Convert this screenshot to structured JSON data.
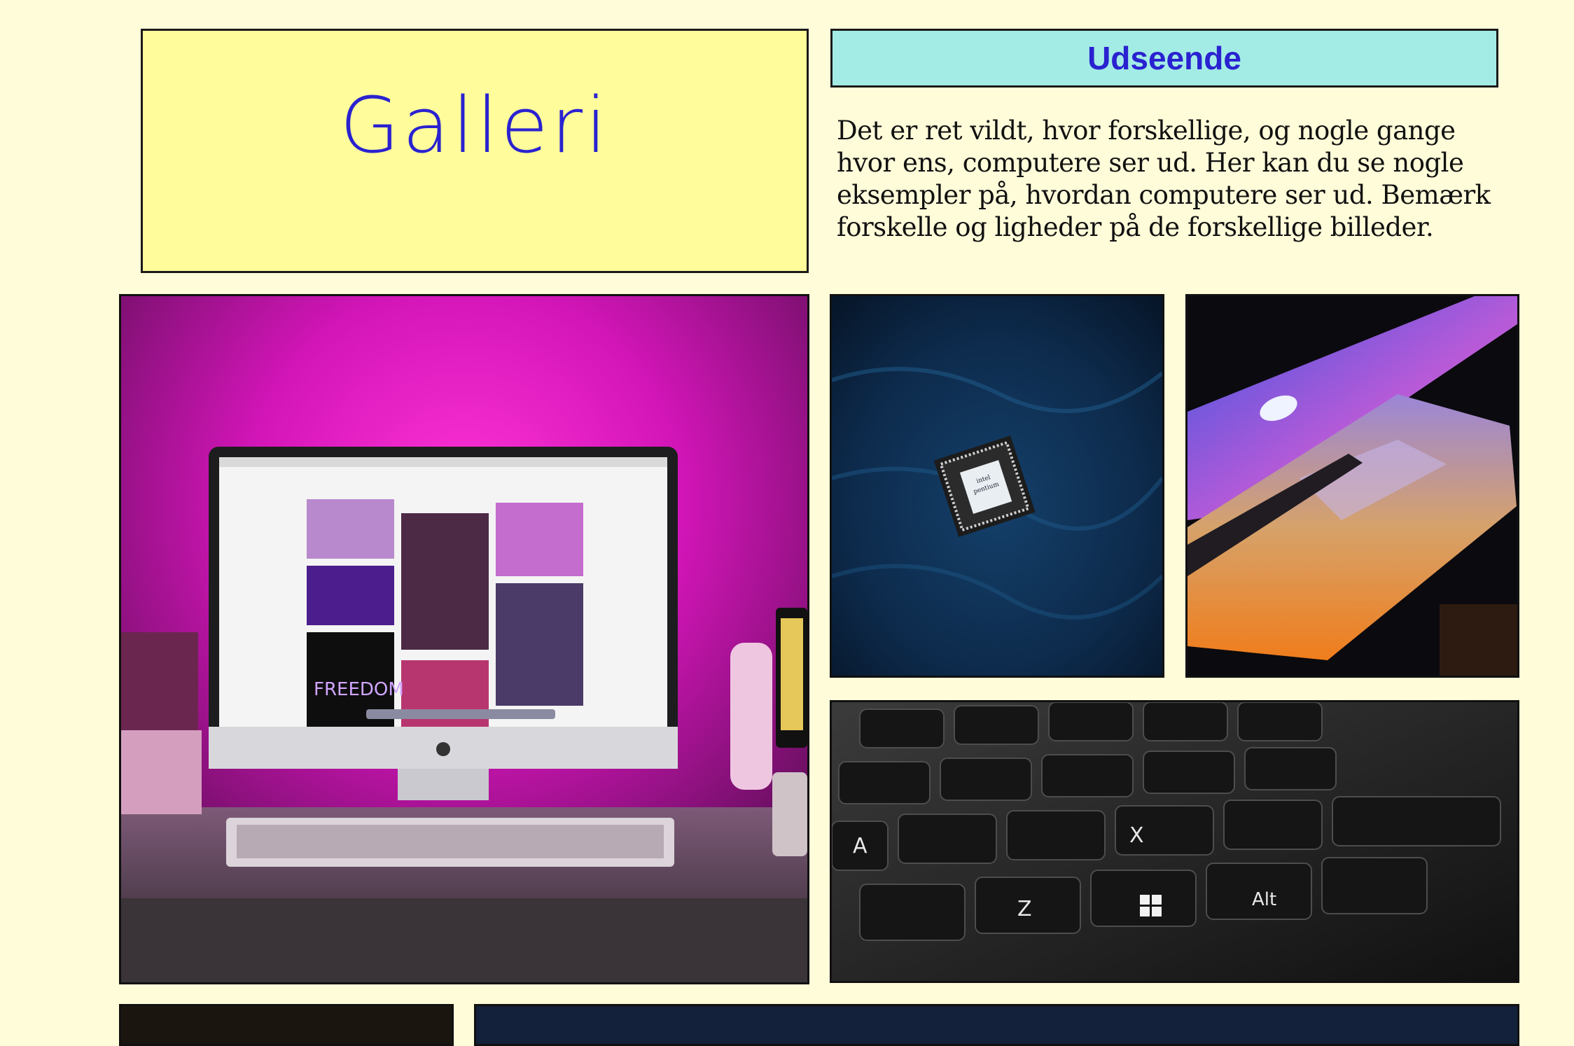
{
  "gallery": {
    "title": "Galleri"
  },
  "appearance": {
    "heading": "Udseende",
    "description": "Det er ret vildt, hvor forskellige, og nogle gange hvor ens, computere ser ud. Her kan du se nogle eksempler på, hvordan computere ser ud. Bemærk forskelle og ligheder på de forskellige billeder."
  },
  "photos": {
    "imac": {
      "screen_text": "FREEDOM"
    },
    "cpu": {
      "chip_label_1": "intel",
      "chip_label_2": "pentium"
    },
    "laptop": {},
    "keyboard": {
      "keys": [
        "A",
        "Z",
        "X",
        "Alt"
      ]
    }
  },
  "colors": {
    "page_background": "#fffcd9",
    "title_box": "#fefc9b",
    "heading_box": "#a3ece6",
    "accent_text": "#2a22d0"
  }
}
